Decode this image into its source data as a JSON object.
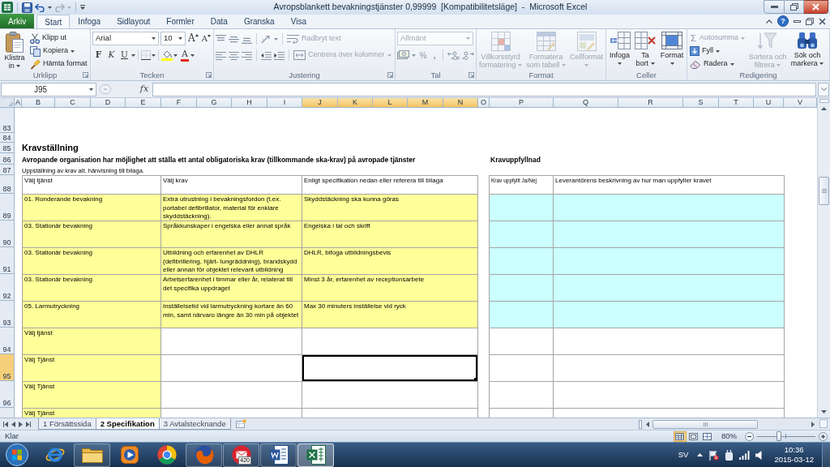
{
  "window": {
    "title": "Avropsblankett bevakningstjänster 0,99999  [Kompatibilitetsläge]  -  Microsoft Excel"
  },
  "ribbon_tabs": [
    {
      "label": "Arkiv",
      "kind": "file",
      "selected": false
    },
    {
      "label": "Start",
      "kind": "tab",
      "selected": true
    },
    {
      "label": "Infoga",
      "kind": "tab",
      "selected": false
    },
    {
      "label": "Sidlayout",
      "kind": "tab",
      "selected": false
    },
    {
      "label": "Formler",
      "kind": "tab",
      "selected": false
    },
    {
      "label": "Data",
      "kind": "tab",
      "selected": false
    },
    {
      "label": "Granska",
      "kind": "tab",
      "selected": false
    },
    {
      "label": "Visa",
      "kind": "tab",
      "selected": false
    }
  ],
  "ribbon": {
    "help": "?",
    "clipboard": {
      "label": "Urklipp",
      "paste": "Klistra in",
      "cut": "Klipp ut",
      "copy": "Kopiera",
      "format_painter": "Hämta format"
    },
    "font": {
      "label": "Tecken",
      "font_name": "Arial",
      "font_size": "10",
      "grow": "A",
      "shrink": "A",
      "bold": "F",
      "italic": "K",
      "underline": "U",
      "font_color": "A"
    },
    "alignment": {
      "label": "Justering",
      "wrap_text": {
        "label": "Radbryt text",
        "disabled": true
      },
      "merge": {
        "label": "Centrera över kolumner",
        "disabled": true
      }
    },
    "number": {
      "label": "Tal",
      "format": {
        "value": "Allmänt",
        "disabled": true
      },
      "percent": "%",
      "comma": ","
    },
    "styles": {
      "label": "Format",
      "buttons": [
        {
          "label": "Villkorsstyrd formatering",
          "disabled": true
        },
        {
          "label": "Formatera som tabell",
          "disabled": true
        },
        {
          "label": "Cellformat",
          "disabled": true
        }
      ]
    },
    "cells": {
      "label": "Celler",
      "buttons": [
        {
          "label": "Infoga",
          "disabled": false
        },
        {
          "label": "Ta bort",
          "disabled": false
        },
        {
          "label": "Format",
          "disabled": false
        }
      ]
    },
    "editing": {
      "label": "Redigering",
      "small_buttons": [
        {
          "symbol": "Σ",
          "label": "Autosumma",
          "disabled": true
        },
        {
          "label": "Fyll",
          "disabled": false
        },
        {
          "label": "Radera",
          "disabled": false
        }
      ],
      "large_buttons": [
        {
          "label": "Sortera och filtrera",
          "disabled": true
        },
        {
          "label": "Sök och markera",
          "disabled": false
        }
      ]
    }
  },
  "formula_bar": {
    "name_box": "J95",
    "function_label": "fx"
  },
  "columns": [
    {
      "label": "A",
      "selected": false
    },
    {
      "label": "B",
      "selected": false
    },
    {
      "label": "C",
      "selected": false
    },
    {
      "label": "D",
      "selected": false
    },
    {
      "label": "E",
      "selected": false
    },
    {
      "label": "F",
      "selected": false
    },
    {
      "label": "G",
      "selected": false
    },
    {
      "label": "H",
      "selected": false
    },
    {
      "label": "I",
      "selected": false
    },
    {
      "label": "J",
      "selected": true
    },
    {
      "label": "K",
      "selected": true
    },
    {
      "label": "L",
      "selected": true
    },
    {
      "label": "M",
      "selected": true
    },
    {
      "label": "N",
      "selected": true
    },
    {
      "label": "O",
      "selected": false
    },
    {
      "label": "P",
      "selected": false
    },
    {
      "label": "Q",
      "selected": false
    },
    {
      "label": "R",
      "selected": false
    },
    {
      "label": "S",
      "selected": false
    },
    {
      "label": "T",
      "selected": false
    },
    {
      "label": "U",
      "selected": false
    },
    {
      "label": "V",
      "selected": false
    }
  ],
  "rows": [
    {
      "label": "83",
      "selected": false
    },
    {
      "label": "84",
      "selected": false
    },
    {
      "label": "85",
      "selected": false
    },
    {
      "label": "86",
      "selected": false
    },
    {
      "label": "87",
      "selected": false
    },
    {
      "label": "88",
      "selected": false
    },
    {
      "label": "89",
      "selected": false
    },
    {
      "label": "90",
      "selected": false
    },
    {
      "label": "91",
      "selected": false
    },
    {
      "label": "92",
      "selected": false
    },
    {
      "label": "93",
      "selected": false
    },
    {
      "label": "94",
      "selected": false
    },
    {
      "label": "95",
      "selected": true
    },
    {
      "label": "96",
      "selected": false
    }
  ],
  "sheet": {
    "title": "Kravställning",
    "subtitle": "Avropande organisation har möjlighet att ställa ett antal obligatoriska krav (tillkommande ska-krav) på avropade tjänster",
    "note": "Uppställning av krav alt. hänvisning till bilaga.",
    "side_title": "Kravuppfyllnad",
    "requirements_table": {
      "columns": [
        "Välj tjänst",
        "Välj krav",
        "Enligt specifikation nedan eller referera till bilaga"
      ],
      "rows": [
        {
          "cells": [
            {
              "text": "01. Ronderande bevakning",
              "highlighted": true,
              "selected": false
            },
            {
              "text": "Extra utrustning i bevakningsfordon (t.ex. portabel defibrillator, material för enklare skyddstäckning).",
              "highlighted": true,
              "selected": false
            },
            {
              "text": "Skyddstäckning ska kunna göras",
              "highlighted": true,
              "selected": false
            }
          ]
        },
        {
          "cells": [
            {
              "text": "03. Stationär bevakning",
              "highlighted": true,
              "selected": false
            },
            {
              "text": "Språkkunskaper i engelska eller annat språk",
              "highlighted": true,
              "selected": false
            },
            {
              "text": "Engelska i tal och skrift",
              "highlighted": true,
              "selected": false
            }
          ]
        },
        {
          "cells": [
            {
              "text": "03. Stationär bevakning",
              "highlighted": true,
              "selected": false
            },
            {
              "text": "Utbildning och erfarenhet av DHLR (defibrillering, hjärt- lungräddning), brandskydd eller annan för objektet relevant utbildning",
              "highlighted": true,
              "selected": false
            },
            {
              "text": "DHLR, bifoga utbildningsbevis",
              "highlighted": true,
              "selected": false
            }
          ]
        },
        {
          "cells": [
            {
              "text": "03. Stationär bevakning",
              "highlighted": true,
              "selected": false
            },
            {
              "text": "Arbetserfarenhet i timmar eller år, relaterat till det specifika uppdraget",
              "highlighted": true,
              "selected": false
            },
            {
              "text": "Minst 3 år, erfarenhet av receptionsarbete",
              "highlighted": true,
              "selected": false
            }
          ]
        },
        {
          "cells": [
            {
              "text": "05. Larmutryckning",
              "highlighted": true,
              "selected": false
            },
            {
              "text": "Inställelsetid vid larmutryckning kortare än 60 min, samt närvaro längre än 30 min på objektet",
              "highlighted": true,
              "selected": false
            },
            {
              "text": "Max 30 minuters inställelse vid ryck",
              "highlighted": true,
              "selected": false
            }
          ]
        },
        {
          "cells": [
            {
              "text": "Välj tjänst",
              "highlighted": true,
              "selected": false
            },
            {
              "highlighted": false,
              "selected": false
            },
            {
              "highlighted": false,
              "selected": false
            }
          ]
        },
        {
          "cells": [
            {
              "text": "Välj Tjänst",
              "highlighted": true,
              "selected": false
            },
            {
              "highlighted": false,
              "selected": false
            },
            {
              "highlighted": false,
              "selected": true
            }
          ]
        },
        {
          "cells": [
            {
              "text": "Välj Tjänst",
              "highlighted": true,
              "selected": false
            },
            {
              "highlighted": false,
              "selected": false
            },
            {
              "highlighted": false,
              "selected": false
            }
          ]
        },
        {
          "cells": [
            {
              "text": "Välj Tjänst",
              "highlighted": true,
              "selected": false
            },
            {
              "highlighted": false,
              "selected": false
            },
            {
              "highlighted": false,
              "selected": false
            }
          ]
        }
      ]
    },
    "fulfilment_table": {
      "columns": [
        "Krav uppfyllt Ja/Nej",
        "Leverantörens beskrivning av hur man uppfyller kravet"
      ],
      "rows": [
        {
          "cells": [
            {
              "highlighted": true,
              "selected": false
            },
            {
              "highlighted": true,
              "selected": false
            }
          ]
        },
        {
          "cells": [
            {
              "highlighted": true,
              "selected": false
            },
            {
              "highlighted": true,
              "selected": false
            }
          ]
        },
        {
          "cells": [
            {
              "highlighted": true,
              "selected": false
            },
            {
              "highlighted": true,
              "selected": false
            }
          ]
        },
        {
          "cells": [
            {
              "highlighted": true,
              "selected": false
            },
            {
              "highlighted": true,
              "selected": false
            }
          ]
        },
        {
          "cells": [
            {
              "highlighted": true,
              "selected": false
            },
            {
              "highlighted": true,
              "selected": false
            }
          ]
        },
        {
          "cells": [
            {
              "highlighted": false,
              "selected": false
            },
            {
              "highlighted": false,
              "selected": false
            }
          ]
        },
        {
          "cells": [
            {
              "highlighted": false,
              "selected": false
            },
            {
              "highlighted": false,
              "selected": false
            }
          ]
        },
        {
          "cells": [
            {
              "highlighted": false,
              "selected": false
            },
            {
              "highlighted": false,
              "selected": false
            }
          ]
        },
        {
          "cells": [
            {
              "highlighted": false,
              "selected": false
            },
            {
              "highlighted": false,
              "selected": false
            }
          ]
        }
      ]
    }
  },
  "sheet_tabs": [
    {
      "label": "1 Försättssida",
      "selected": false
    },
    {
      "label": "2 Specifikation",
      "selected": true
    },
    {
      "label": "3 Avtalstecknande",
      "selected": false
    }
  ],
  "status_bar": {
    "status": "Klar",
    "views": [
      {
        "kind": "normal",
        "selected": true
      },
      {
        "kind": "layout",
        "selected": false
      },
      {
        "kind": "breaks",
        "selected": false
      }
    ],
    "zoom": "80%",
    "zoom_slider": {
      "level": 0.38
    }
  },
  "taskbar": {
    "apps": [
      {
        "kind": "browser",
        "running": false,
        "selected": false
      },
      {
        "kind": "folder",
        "running": true,
        "selected": false
      },
      {
        "kind": "player",
        "running": false,
        "selected": false
      },
      {
        "kind": "wheel",
        "running": false,
        "selected": false
      },
      {
        "kind": "fox",
        "running": true,
        "selected": false
      },
      {
        "kind": "mail",
        "running": true,
        "selected": false,
        "badge": "420"
      },
      {
        "kind": "writer",
        "running": true,
        "selected": false
      },
      {
        "kind": "sheet",
        "running": true,
        "selected": true
      }
    ],
    "language": "SV",
    "time": "10:36",
    "date": "2015-03-12"
  }
}
